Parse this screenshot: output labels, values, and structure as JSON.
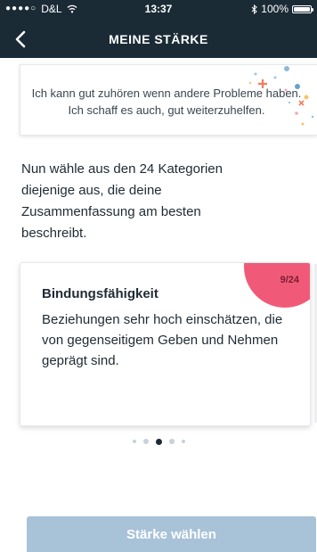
{
  "status_bar": {
    "carrier": "D&L",
    "time": "13:37",
    "battery": "100%"
  },
  "header": {
    "back_icon": "chevron-left-icon",
    "title": "MEINE STÄRKE"
  },
  "summary": {
    "text": "Ich kann gut zuhören wenn andere Probleme haben. Ich schaff es auch, gut weiterzuhelfen."
  },
  "instruction": "Nun wähle aus den 24 Kategorien diejenige aus, die deine Zusammenfassung am besten beschreibt.",
  "category_card": {
    "counter": "9/24",
    "title": "Bindungsfähigkeit",
    "description": "Beziehungen sehr hoch einschätzen, die von gegenseitigem Geben und Nehmen geprägt sind."
  },
  "pager": {
    "pages": 5,
    "active_index": 2
  },
  "action": {
    "label": "Stärke wählen"
  },
  "colors": {
    "header_bg": "#1b2b36",
    "badge": "#f05a78",
    "button_bg": "#a8c2d8",
    "dot_inactive": "#c8d1da",
    "dot_active": "#1b2b36"
  }
}
